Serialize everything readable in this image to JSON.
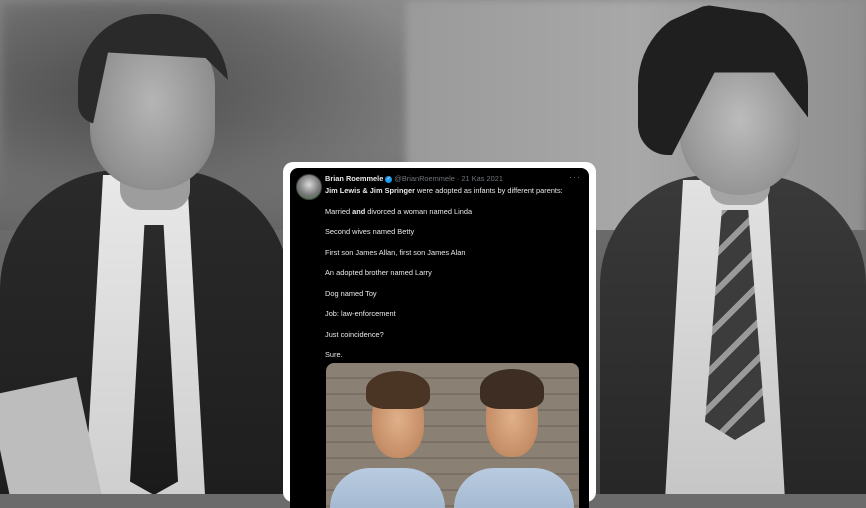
{
  "tweet": {
    "name": "Brian Roemmele",
    "handle": "@BrianRoemmele",
    "separator": "·",
    "date": "21 Kas 2021",
    "more": "···",
    "intro_name1": "Jim Lewis",
    "intro_amp": " & ",
    "intro_name2": "Jim Springer",
    "intro_rest": " were adopted as infants by different parents:",
    "line_married_a": "Married ",
    "line_married_and": "and",
    "line_married_b": " divorced a woman named Linda",
    "line_wives": "Second wives named Betty",
    "line_sons": "First son James Allan, first son James Alan",
    "line_brother": "An adopted brother named Larry",
    "line_dog": "Dog named Toy",
    "line_job": "Job: law-enforcement",
    "line_coincidence": "Just coincidence?",
    "line_sure": "Sure."
  }
}
